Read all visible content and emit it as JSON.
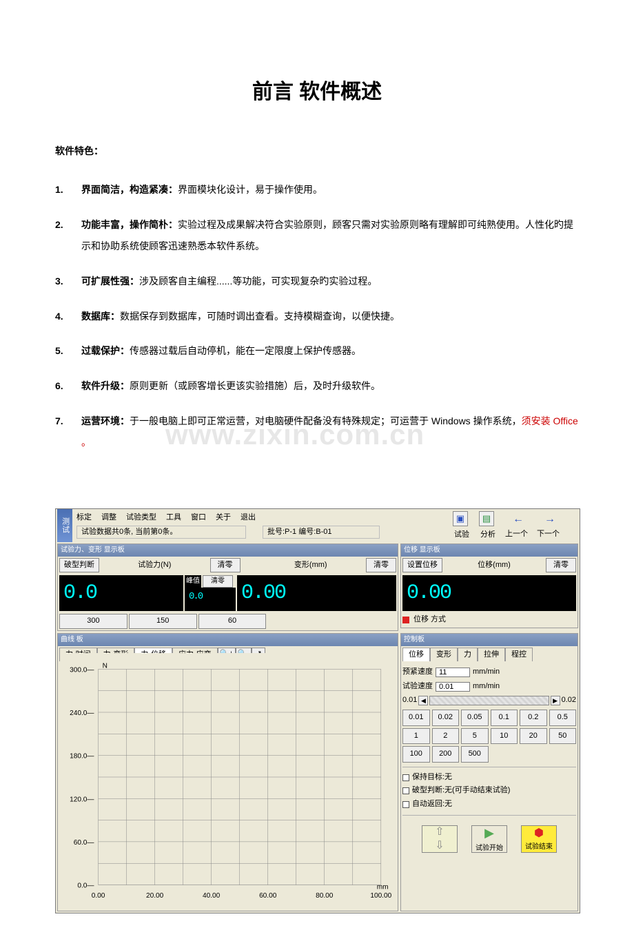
{
  "title": "前言  软件概述",
  "section": "软件特色：",
  "features": [
    {
      "lead": "界面简洁，构造紧凑：",
      "body": "界面模块化设计，易于操作使用。"
    },
    {
      "lead": "功能丰富，操作简朴：",
      "body": "实验过程及成果解决符合实验原则，顾客只需对实验原则略有理解即可纯熟使用。人性化旳提示和协助系统使顾客迅速熟悉本软件系统。"
    },
    {
      "lead": "可扩展性强：",
      "body": "涉及顾客自主编程......等功能，可实现复杂旳实验过程。"
    },
    {
      "lead": "数据库：",
      "body": "数据保存到数据库，可随时调出查看。支持模糊查询，以便快捷。"
    },
    {
      "lead": "过载保护：",
      "body": "传感器过载后自动停机，能在一定限度上保护传感器。"
    },
    {
      "lead": "软件升级：",
      "body": "原则更新（或顾客增长更该实验措施）后，及时升级软件。"
    },
    {
      "lead": "运营环境：",
      "body": "于一般电脑上即可正常运营，对电脑硬件配备没有特殊规定；可运营于 Windows 操作系统，",
      "red": "须安装 Office 。"
    }
  ],
  "watermark": "www.zixin.com.cn",
  "app": {
    "name": "测试",
    "menu": [
      "标定",
      "调整",
      "试验类型",
      "工具",
      "窗口",
      "关于",
      "退出"
    ],
    "status": "试验数据共0条, 当前第0条。",
    "batch": "批号:P-1 编号:B-01",
    "rtb": {
      "test": "试验",
      "analyze": "分析",
      "prev": "上一个",
      "next": "下一个"
    },
    "panelL1": {
      "title": "试验力、变形 显示板",
      "break_btn": "破型判断",
      "force_lbl": "试验力(N)",
      "zero": "清零",
      "peak_lbl": "峰值",
      "deform_lbl": "变形(mm)",
      "force_val": "0.0",
      "peak_val": "0.0",
      "deform_val": "0.00",
      "btns": [
        "300",
        "150",
        "60"
      ]
    },
    "panelR1": {
      "title": "位移 显示板",
      "set_btn": "设置位移",
      "disp_lbl": "位移(mm)",
      "zero": "清零",
      "disp_val": "0.00",
      "mode": "位移 方式"
    },
    "panelL2": {
      "title": "曲线 板",
      "tabs": [
        "力-时间",
        "力-变形",
        "力-位移",
        "应力-应变"
      ],
      "yticks": [
        "300.0",
        "240.0",
        "180.0",
        "120.0",
        "60.0",
        "0.0"
      ],
      "xticks": [
        "0.00",
        "20.00",
        "40.00",
        "60.00",
        "80.00",
        "100.00"
      ],
      "yunit": "N",
      "xunit": "mm"
    },
    "panelR2": {
      "title": "控制板",
      "tabs": [
        "位移",
        "变形",
        "力",
        "拉伸",
        "程控"
      ],
      "pre_lbl": "预紧速度",
      "pre_val": "11",
      "unit": "mm/min",
      "test_lbl": "试验速度",
      "test_val": "0.01",
      "s_lo": "0.01",
      "s_hi": "0.02",
      "speeds": [
        "0.01",
        "0.02",
        "0.05",
        "0.1",
        "0.2",
        "0.5",
        "1",
        "2",
        "5",
        "10",
        "20",
        "50",
        "100",
        "200",
        "500"
      ],
      "chk1": "保持目标:无",
      "chk2": "破型判断:无(可手动结束试验)",
      "chk3": "自动返回:无",
      "start": "试验开始",
      "stop": "试验结束"
    }
  },
  "chart_data": {
    "type": "line",
    "title": "",
    "xlabel": "mm",
    "ylabel": "N",
    "xlim": [
      0,
      100
    ],
    "ylim": [
      0,
      300
    ],
    "series": [
      {
        "name": "力-位移",
        "values": []
      }
    ],
    "x": []
  }
}
